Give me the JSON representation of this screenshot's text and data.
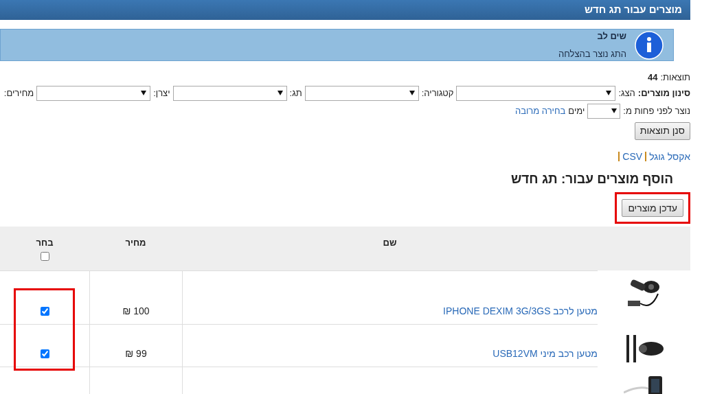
{
  "header": {
    "title": "מוצרים עבור תג חדש"
  },
  "notice": {
    "title": "שים לב",
    "message": "התג נוצר בהצלחה"
  },
  "results": {
    "label": "תוצאות:",
    "count": "44"
  },
  "filters": {
    "title": "סינון מוצרים:",
    "fields": [
      {
        "label": "הצג:",
        "kind": "dropdown"
      },
      {
        "label": "קטגוריה:",
        "kind": "dropdown"
      },
      {
        "label": "תג:",
        "kind": "dropdown"
      },
      {
        "label": "יצרן:",
        "kind": "dropdown"
      },
      {
        "label": "מחירים:",
        "kind": "label"
      }
    ],
    "age_label": "נוצר לפני פחות מ:",
    "age_unit": "ימים",
    "multi_link": "בחירה מרובה",
    "filter_button": "סנן תוצאות"
  },
  "exports": [
    {
      "label": "אקסל גוגל"
    },
    {
      "label": "CSV"
    }
  ],
  "section_title": "הוסף מוצרים עבור: תג חדש",
  "update_button": {
    "label": "עדכן מוצרים",
    "highlighted": true
  },
  "table": {
    "columns": [
      "שם",
      "מחיר",
      "בחר"
    ],
    "select_all_checked": false,
    "selection_highlighted": true,
    "rows": [
      {
        "kind": "full",
        "name": "מטען לרכב IPHONE DEXIM 3G/3GS",
        "price": "100 ₪",
        "checked": true
      },
      {
        "kind": "full",
        "name": "מטען רכב מיני USB12VM",
        "price": "99 ₪",
        "checked": true
      },
      {
        "kind": "cut"
      }
    ]
  }
}
